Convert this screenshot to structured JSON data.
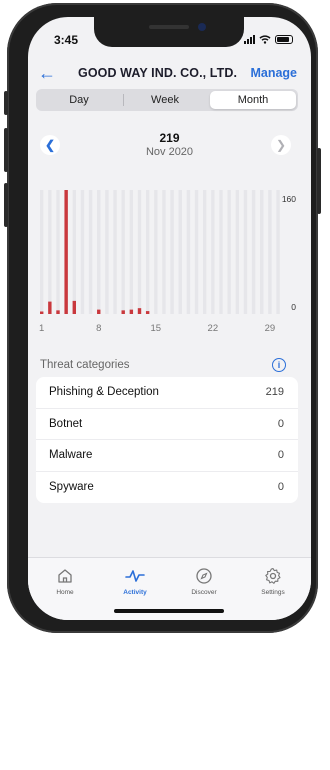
{
  "status": {
    "time": "3:45"
  },
  "header": {
    "title": "GOOD WAY IND. CO., LTD.",
    "manage_label": "Manage"
  },
  "segment": {
    "items": [
      "Day",
      "Week",
      "Month"
    ],
    "selected": "Month"
  },
  "summary": {
    "total": "219",
    "period": "Nov 2020"
  },
  "chart_data": {
    "type": "bar",
    "categories": [
      "1",
      "2",
      "3",
      "4",
      "5",
      "6",
      "7",
      "8",
      "9",
      "10",
      "11",
      "12",
      "13",
      "14",
      "15",
      "16",
      "17",
      "18",
      "19",
      "20",
      "21",
      "22",
      "23",
      "24",
      "25",
      "26",
      "27",
      "28",
      "29",
      "30"
    ],
    "values": [
      3,
      17,
      5,
      170,
      18,
      0,
      0,
      6,
      0,
      0,
      5,
      6,
      8,
      4,
      0,
      0,
      0,
      0,
      0,
      0,
      0,
      0,
      0,
      0,
      0,
      0,
      0,
      0,
      0,
      0
    ],
    "xticks": [
      "1",
      "8",
      "15",
      "22",
      "29"
    ],
    "yticks": [
      "160",
      "0"
    ],
    "ylim": [
      0,
      170
    ],
    "bar_color": "#c9383d",
    "track_color": "#e6e6ea"
  },
  "categories": {
    "heading": "Threat categories",
    "items": [
      {
        "label": "Phishing & Deception",
        "count": "219"
      },
      {
        "label": "Botnet",
        "count": "0"
      },
      {
        "label": "Malware",
        "count": "0"
      },
      {
        "label": "Spyware",
        "count": "0"
      }
    ]
  },
  "tabbar": {
    "items": [
      {
        "label": "Home",
        "icon": "home-icon"
      },
      {
        "label": "Activity",
        "icon": "activity-icon"
      },
      {
        "label": "Discover",
        "icon": "compass-icon"
      },
      {
        "label": "Settings",
        "icon": "gear-icon"
      }
    ],
    "active": "Activity"
  },
  "colors": {
    "accent": "#2b6fd8",
    "threat": "#c9383d"
  }
}
